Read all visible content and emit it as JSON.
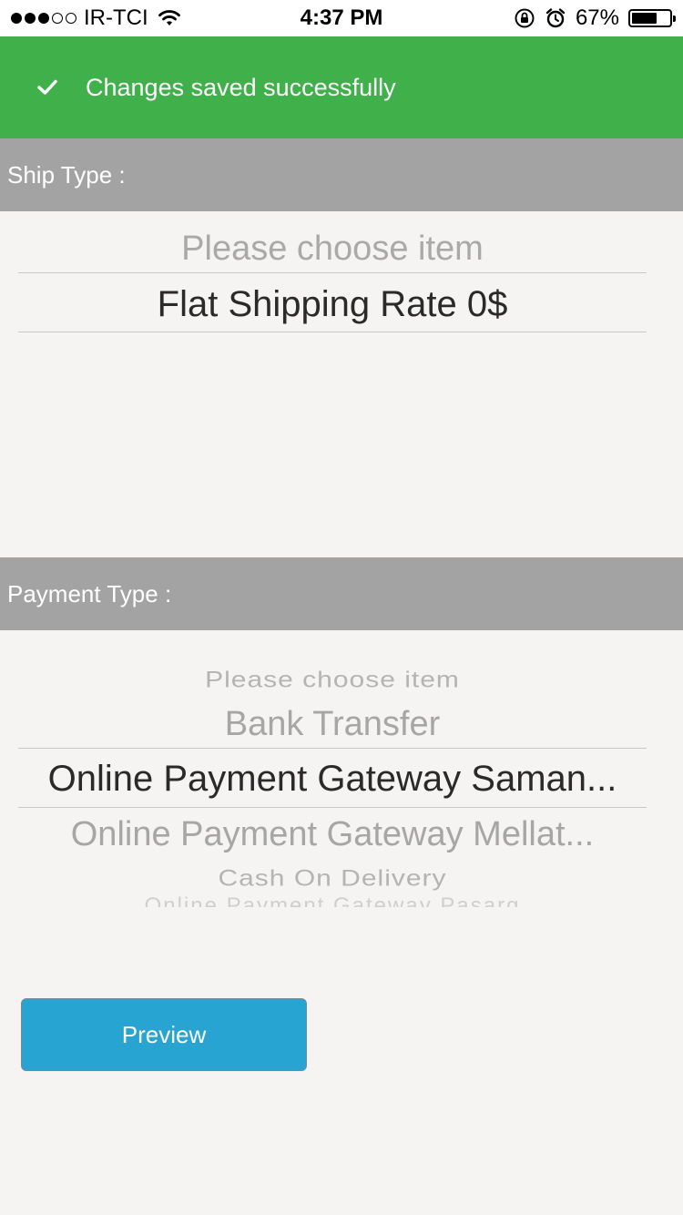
{
  "status_bar": {
    "carrier": "IR-TCI",
    "time": "4:37 PM",
    "battery_percent": "67%",
    "battery_level": 0.67,
    "signal_bars": 3,
    "signal_total": 5,
    "icons": [
      "signal-dots-icon",
      "wifi-icon",
      "rotation-lock-icon",
      "alarm-icon",
      "battery-icon"
    ]
  },
  "toast": {
    "message": "Changes saved successfully",
    "icon": "check-icon",
    "color": "#3fb04a"
  },
  "ship_section": {
    "label": "Ship Type :",
    "picker": {
      "placeholder": "Please choose item",
      "selected": "Flat Shipping Rate 0$"
    }
  },
  "payment_section": {
    "label": "Payment Type :",
    "picker": {
      "items_above": [
        "Please choose item",
        "Bank Transfer"
      ],
      "selected": "Online Payment Gateway Saman...",
      "items_below": [
        "Online Payment Gateway Mellat...",
        "Cash On Delivery",
        "Online Payment Gateway Pasarg"
      ]
    }
  },
  "actions": {
    "preview_label": "Preview",
    "preview_color": "#28a4d3"
  },
  "colors": {
    "header_bg": "#a3a3a3",
    "page_bg": "#f5f4f2"
  }
}
